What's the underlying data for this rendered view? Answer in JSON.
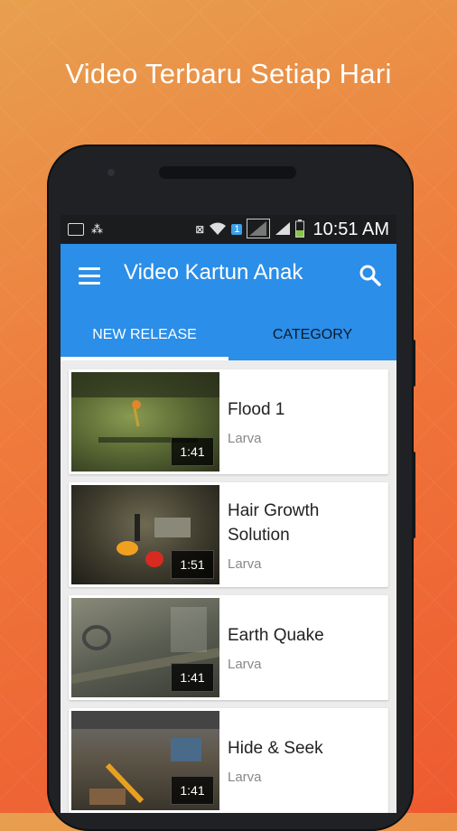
{
  "headline": "Video Terbaru Setiap Hari",
  "status_bar": {
    "time": "10:51 AM",
    "sim_badge": "1"
  },
  "app_bar": {
    "title": "Video Kartun Anak",
    "icons": [
      "menu-icon",
      "search-icon"
    ]
  },
  "tabs": [
    {
      "label": "NEW RELEASE",
      "active": true
    },
    {
      "label": "CATEGORY",
      "active": false
    }
  ],
  "videos": [
    {
      "title": "Flood 1",
      "channel": "Larva",
      "duration": "1:41"
    },
    {
      "title": "Hair Growth Solution",
      "channel": "Larva",
      "duration": "1:51"
    },
    {
      "title": "Earth Quake",
      "channel": "Larva",
      "duration": "1:41"
    },
    {
      "title": "Hide & Seek",
      "channel": "Larva",
      "duration": "1:41"
    }
  ],
  "colors": {
    "app_bar": "#2b8ee8",
    "background_top": "#e7a04f",
    "background_bottom": "#ee5a30"
  }
}
